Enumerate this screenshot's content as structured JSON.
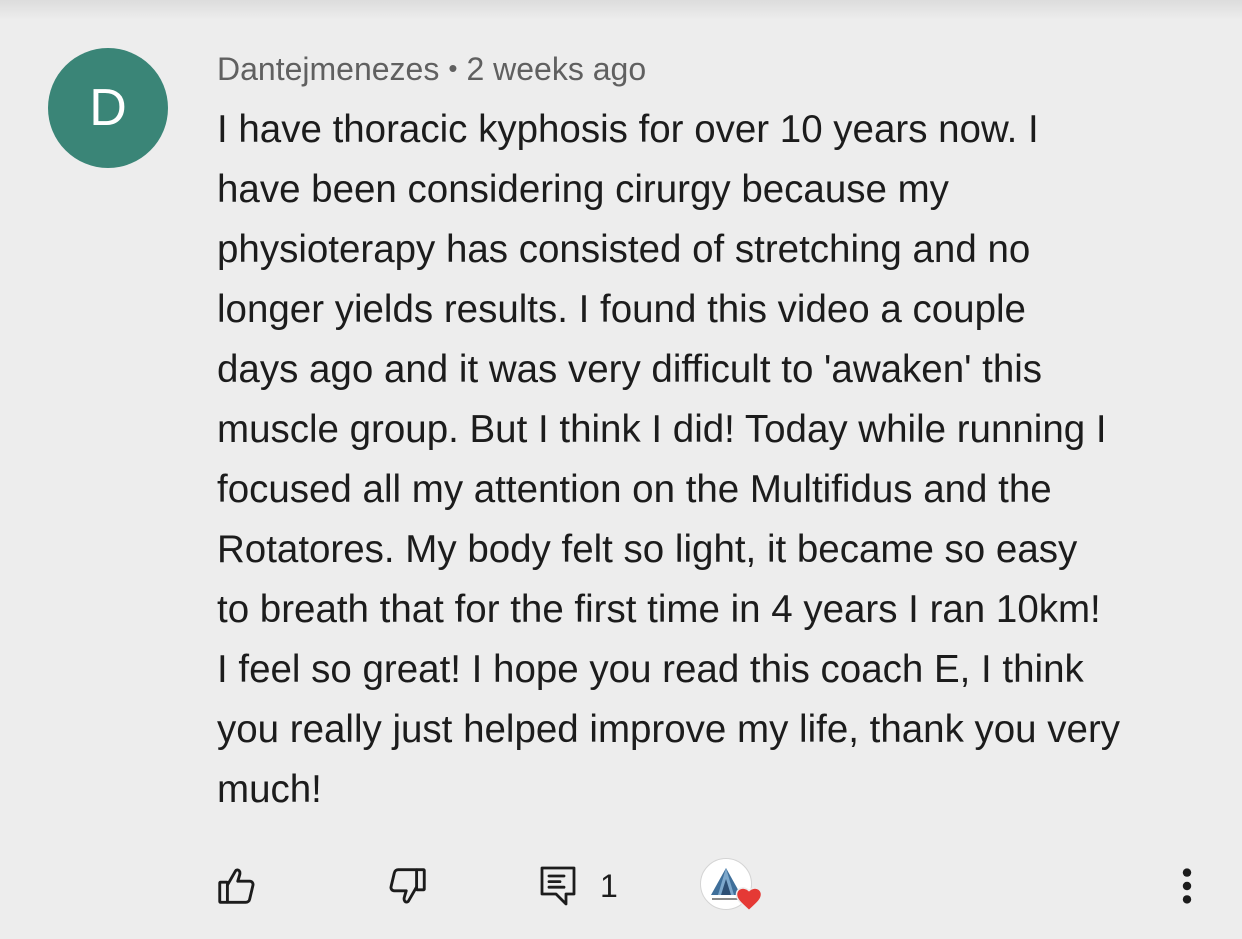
{
  "comment": {
    "avatar_letter": "D",
    "avatar_color": "#3a8577",
    "author": "Dantejmenezes",
    "separator": "•",
    "timestamp": "2 weeks ago",
    "lines": [
      "I have thoracic kyphosis for over 10 years now. I",
      "have been considering cirurgy because my",
      "physioterapy has consisted of stretching and no",
      "longer yields results. I found this video a couple",
      "days ago and it was very difficult to 'awaken' this",
      "muscle group. But I think I did! Today while running I",
      "focused all my attention on the Multifidus and the",
      "Rotatores. My body felt so light, it became so easy",
      "to breath that for the first time in 4 years I ran 10km!",
      "I feel so great! I hope you read this coach E, I think",
      "you really just helped improve my life, thank you very",
      "much!"
    ]
  },
  "actions": {
    "like_icon": "thumbs-up-icon",
    "dislike_icon": "thumbs-down-icon",
    "reply_icon": "reply-icon",
    "reply_count": "1",
    "creator_heart_icon": "heart-icon",
    "heart_color": "#e53935",
    "menu_icon": "more-vert-icon"
  }
}
